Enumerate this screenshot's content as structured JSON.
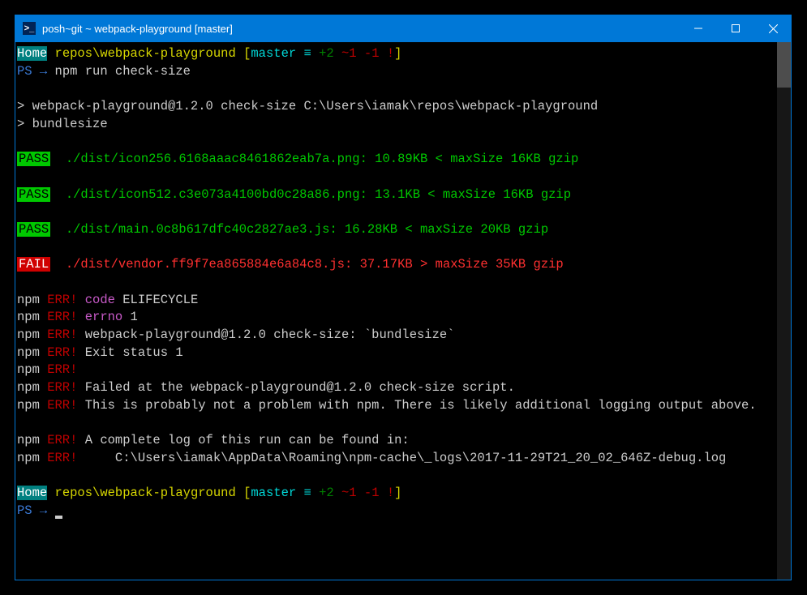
{
  "titlebar": {
    "icon_label": ">_",
    "title": "posh~git ~ webpack-playground [master]"
  },
  "prompt1": {
    "home": "Home",
    "path": " repos\\webpack-playground ",
    "br_open": "[",
    "branch": "master",
    "equiv": " ≡ ",
    "plus": "+2",
    "tilde": " ~1",
    "minus": " -1",
    "bang": " !",
    "br_close": "]"
  },
  "cmd1": {
    "ps": "PS",
    "arrow": " → ",
    "cmd": "npm run check-size"
  },
  "npm_header1": "> webpack-playground@1.2.0 check-size C:\\Users\\iamak\\repos\\webpack-playground",
  "npm_header2": "> bundlesize",
  "results": [
    {
      "status": "PASS",
      "text": "  ./dist/icon256.6168aaac8461862eab7a.png: 10.89KB < maxSize 16KB gzip"
    },
    {
      "status": "PASS",
      "text": "  ./dist/icon512.c3e073a4100bd0c28a86.png: 13.1KB < maxSize 16KB gzip"
    },
    {
      "status": "PASS",
      "text": "  ./dist/main.0c8b617dfc40c2827ae3.js: 16.28KB < maxSize 20KB gzip"
    },
    {
      "status": "FAIL",
      "text": "  ./dist/vendor.ff9f7ea865884e6a84c8.js: 37.17KB > maxSize 35KB gzip"
    }
  ],
  "err": {
    "npm": "npm",
    "err": " ERR!",
    "code_lbl": " code",
    "code_val": " ELIFECYCLE",
    "errno_lbl": " errno",
    "errno_val": " 1",
    "line3": " webpack-playground@1.2.0 check-size: `bundlesize`",
    "line4": " Exit status 1",
    "line6": " Failed at the webpack-playground@1.2.0 check-size script.",
    "line7": " This is probably not a problem with npm. There is likely additional logging output above.",
    "line8": " A complete log of this run can be found in:",
    "line9": "     C:\\Users\\iamak\\AppData\\Roaming\\npm-cache\\_logs\\2017-11-29T21_20_02_646Z-debug.log"
  },
  "prompt2": {
    "ps": "PS",
    "arrow": " → "
  }
}
